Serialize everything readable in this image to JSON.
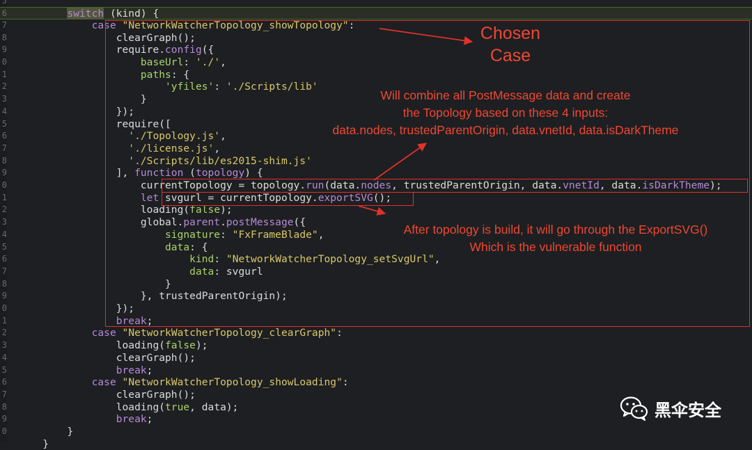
{
  "editor": {
    "line_numbers": [
      "5",
      "6",
      "7",
      "8",
      "9",
      "0",
      "1",
      "2",
      "3",
      "4",
      "5",
      "6",
      "7",
      "8",
      "9",
      "0",
      "1",
      "2",
      "3",
      "4",
      "5",
      "6",
      "7",
      "8",
      "9",
      "0",
      "1",
      "2",
      "3",
      "4",
      "5",
      "6",
      "7",
      "8",
      "9",
      "0"
    ],
    "lines": [
      [
        [
          "",
          ""
        ]
      ],
      [
        [
          "            ",
          ""
        ],
        [
          "switch",
          "sel"
        ],
        [
          " (kind) {",
          ""
        ]
      ],
      [
        [
          "                ",
          ""
        ],
        [
          "case",
          "kw"
        ],
        [
          " ",
          ""
        ],
        [
          "\"NetworkWatcherTopology_showTopology\"",
          "str"
        ],
        [
          ":",
          ""
        ]
      ],
      [
        [
          "                    clearGraph();",
          ""
        ]
      ],
      [
        [
          "                    require.",
          ""
        ],
        [
          "config",
          "kw"
        ],
        [
          "({",
          ""
        ]
      ],
      [
        [
          "                        ",
          ""
        ],
        [
          "baseUrl",
          "prop"
        ],
        [
          ": ",
          ""
        ],
        [
          "'./'",
          "str"
        ],
        [
          ",",
          ""
        ]
      ],
      [
        [
          "                        ",
          ""
        ],
        [
          "paths",
          "prop"
        ],
        [
          ": {",
          ""
        ]
      ],
      [
        [
          "                            ",
          ""
        ],
        [
          "'yfiles'",
          "prop"
        ],
        [
          ": ",
          ""
        ],
        [
          "'./Scripts/lib'",
          "str"
        ]
      ],
      [
        [
          "                        }",
          ""
        ]
      ],
      [
        [
          "                    });",
          ""
        ]
      ],
      [
        [
          "                    require([",
          ""
        ]
      ],
      [
        [
          "                      ",
          ""
        ],
        [
          "'./Topology.js'",
          "str"
        ],
        [
          ",",
          ""
        ]
      ],
      [
        [
          "                      ",
          ""
        ],
        [
          "'./license.js'",
          "str"
        ],
        [
          ",",
          ""
        ]
      ],
      [
        [
          "                      ",
          ""
        ],
        [
          "'./Scripts/lib/es2015-shim.js'",
          "str"
        ]
      ],
      [
        [
          "                    ], ",
          ""
        ],
        [
          "function",
          "kw"
        ],
        [
          " (",
          ""
        ],
        [
          "topology",
          "kw"
        ],
        [
          ") {",
          ""
        ]
      ],
      [
        [
          "                        currentTopology = topology.",
          ""
        ],
        [
          "run",
          "kw"
        ],
        [
          "(data.",
          ""
        ],
        [
          "nodes",
          "kw"
        ],
        [
          ", trustedParentOrigin, data.",
          ""
        ],
        [
          "vnetId",
          "kw"
        ],
        [
          ", data.",
          ""
        ],
        [
          "isDarkTheme",
          "kw"
        ],
        [
          ");",
          ""
        ]
      ],
      [
        [
          "                        ",
          ""
        ],
        [
          "let",
          "kw"
        ],
        [
          " svgurl = currentTopology.",
          ""
        ],
        [
          "exportSVG",
          "kw"
        ],
        [
          "();",
          ""
        ]
      ],
      [
        [
          "                        loading(",
          ""
        ],
        [
          "false",
          "prop"
        ],
        [
          ");",
          ""
        ]
      ],
      [
        [
          "                        global.",
          ""
        ],
        [
          "parent",
          "kw"
        ],
        [
          ".",
          ""
        ],
        [
          "postMessage",
          "kw"
        ],
        [
          "({",
          ""
        ]
      ],
      [
        [
          "                            ",
          ""
        ],
        [
          "signature",
          "prop"
        ],
        [
          ": ",
          ""
        ],
        [
          "\"FxFrameBlade\"",
          "str"
        ],
        [
          ",",
          ""
        ]
      ],
      [
        [
          "                            ",
          ""
        ],
        [
          "data",
          "prop"
        ],
        [
          ": {",
          ""
        ]
      ],
      [
        [
          "                                ",
          ""
        ],
        [
          "kind",
          "prop"
        ],
        [
          ": ",
          ""
        ],
        [
          "\"NetworkWatcherTopology_setSvgUrl\"",
          "str"
        ],
        [
          ",",
          ""
        ]
      ],
      [
        [
          "                                ",
          ""
        ],
        [
          "data",
          "prop"
        ],
        [
          ": svgurl",
          ""
        ]
      ],
      [
        [
          "                            }",
          ""
        ]
      ],
      [
        [
          "                        }, trustedParentOrigin);",
          ""
        ]
      ],
      [
        [
          "                    });",
          ""
        ]
      ],
      [
        [
          "                    ",
          ""
        ],
        [
          "break",
          "kw"
        ],
        [
          ";",
          ""
        ]
      ],
      [
        [
          "                ",
          ""
        ],
        [
          "case",
          "kw"
        ],
        [
          " ",
          ""
        ],
        [
          "\"NetworkWatcherTopology_clearGraph\"",
          "str"
        ],
        [
          ":",
          ""
        ]
      ],
      [
        [
          "                    loading(",
          ""
        ],
        [
          "false",
          "prop"
        ],
        [
          ");",
          ""
        ]
      ],
      [
        [
          "                    clearGraph();",
          ""
        ]
      ],
      [
        [
          "                    ",
          ""
        ],
        [
          "break",
          "kw"
        ],
        [
          ";",
          ""
        ]
      ],
      [
        [
          "                ",
          ""
        ],
        [
          "case",
          "kw"
        ],
        [
          " ",
          ""
        ],
        [
          "\"NetworkWatcherTopology_showLoading\"",
          "str"
        ],
        [
          ":",
          ""
        ]
      ],
      [
        [
          "                    clearGraph();",
          ""
        ]
      ],
      [
        [
          "                    loading(",
          ""
        ],
        [
          "true",
          "prop"
        ],
        [
          ", data);",
          ""
        ]
      ],
      [
        [
          "                    ",
          ""
        ],
        [
          "break",
          "kw"
        ],
        [
          ";",
          ""
        ]
      ],
      [
        [
          "            }",
          ""
        ]
      ],
      [
        [
          "        }",
          ""
        ]
      ]
    ]
  },
  "annotations": {
    "chosen_case_line1": "Chosen",
    "chosen_case_line2": "Case",
    "combine_line1": "Will combine all PostMessage data and create",
    "combine_line2": "the Topology based on these 4 inputs:",
    "combine_line3": "data.nodes, trustedParentOrigin, data.vnetId, data.isDarkTheme",
    "export_line1": "After topology is build, it will go through the ExportSVG()",
    "export_line2": "Which is the vulnerable function"
  },
  "watermark": {
    "text": "黑伞安全",
    "icon": "wechat-icon"
  },
  "colors": {
    "annotation_red": "#ef4732",
    "keyword": "#b48ad6",
    "string": "#d8c86a",
    "property": "#a9d468"
  }
}
